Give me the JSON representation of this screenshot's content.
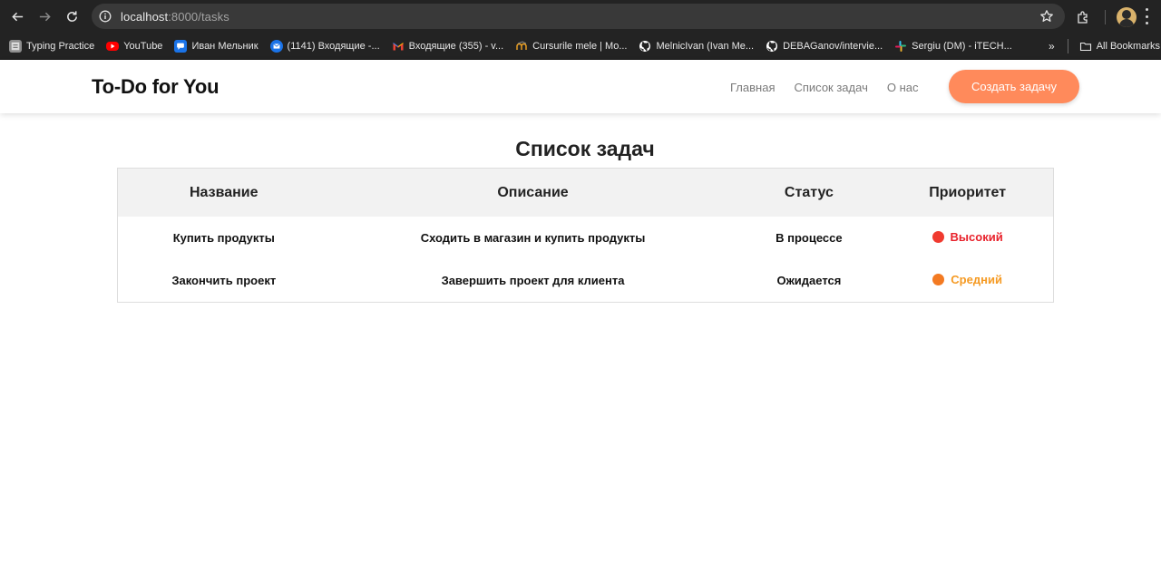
{
  "browser": {
    "url_host": "localhost",
    "url_path": ":8000/tasks",
    "bookmarks": [
      {
        "label": "Typing Practice",
        "icon": "typing-icon",
        "color": "#9e9e9e"
      },
      {
        "label": "YouTube",
        "icon": "youtube-icon",
        "color": "#ff0000"
      },
      {
        "label": "Иван Мельник",
        "icon": "chat-icon",
        "color": "#1a73e8"
      },
      {
        "label": "(1141) Входящие -...",
        "icon": "mail-icon",
        "color": "#1a73e8"
      },
      {
        "label": "Входящие (355) - v...",
        "icon": "gmail-icon",
        "color": "#ea4335"
      },
      {
        "label": "Cursurile mele | Mo...",
        "icon": "moodle-icon",
        "color": "#f5a623"
      },
      {
        "label": "MelnicIvan (Ivan Me...",
        "icon": "github-icon",
        "color": "#ffffff"
      },
      {
        "label": "DEBAGanov/intervie...",
        "icon": "github-icon",
        "color": "#ffffff"
      },
      {
        "label": "Sergiu (DM) - iTECH...",
        "icon": "slack-icon",
        "color": "#e01e5a"
      }
    ],
    "all_bookmarks_label": "All Bookmarks"
  },
  "header": {
    "logo": "To-Do for You",
    "nav": [
      "Главная",
      "Список задач",
      "О нас"
    ],
    "cta_label": "Создать задачу",
    "cta_color": "#ff8a5b"
  },
  "main": {
    "title": "Список задач",
    "columns": [
      "Название",
      "Описание",
      "Статус",
      "Приоритет"
    ],
    "rows": [
      {
        "name": "Купить продукты",
        "description": "Сходить в магазин и купить продукты",
        "status": "В процессе",
        "priority": "Высокий",
        "priority_color": "#e8212b",
        "dot_color": "#f03a2f"
      },
      {
        "name": "Закончить проект",
        "description": "Завершить проект для клиента",
        "status": "Ожидается",
        "priority": "Средний",
        "priority_color": "#f59a23",
        "dot_color": "#f37a22"
      }
    ]
  }
}
